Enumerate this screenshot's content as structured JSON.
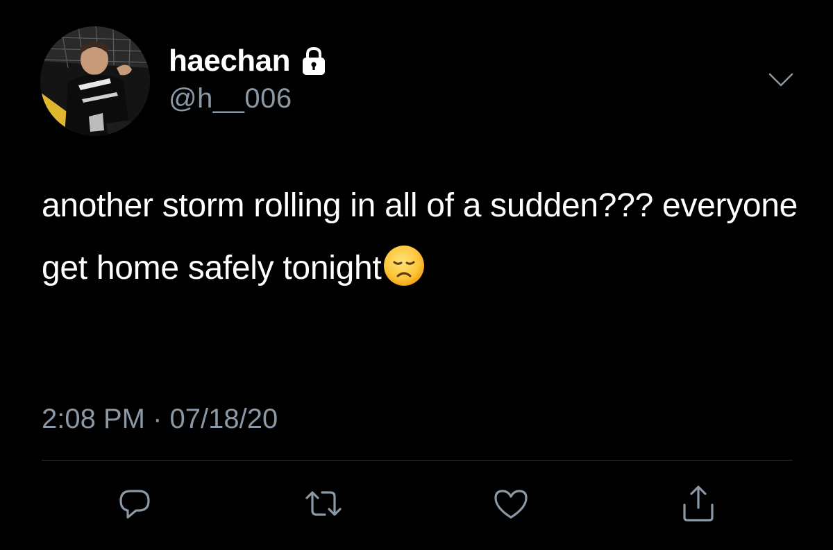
{
  "user": {
    "display_name": "haechan",
    "handle": "@h__006",
    "protected_icon": "lock-icon",
    "avatar_alt": "profile photo"
  },
  "tweet": {
    "text": "another storm rolling in all of a sudden??? everyone get home safely tonight",
    "emoji": "disappointed-face-emoji",
    "timestamp": "2:08 PM · 07/18/20"
  },
  "actions": [
    {
      "icon": "reply-icon"
    },
    {
      "icon": "retweet-icon"
    },
    {
      "icon": "like-icon"
    },
    {
      "icon": "share-icon"
    }
  ],
  "colors": {
    "background": "#000000",
    "primary_text": "#ffffff",
    "secondary_text": "#8b98a5",
    "divider": "#2f3336",
    "icon": "#8b98a5"
  }
}
